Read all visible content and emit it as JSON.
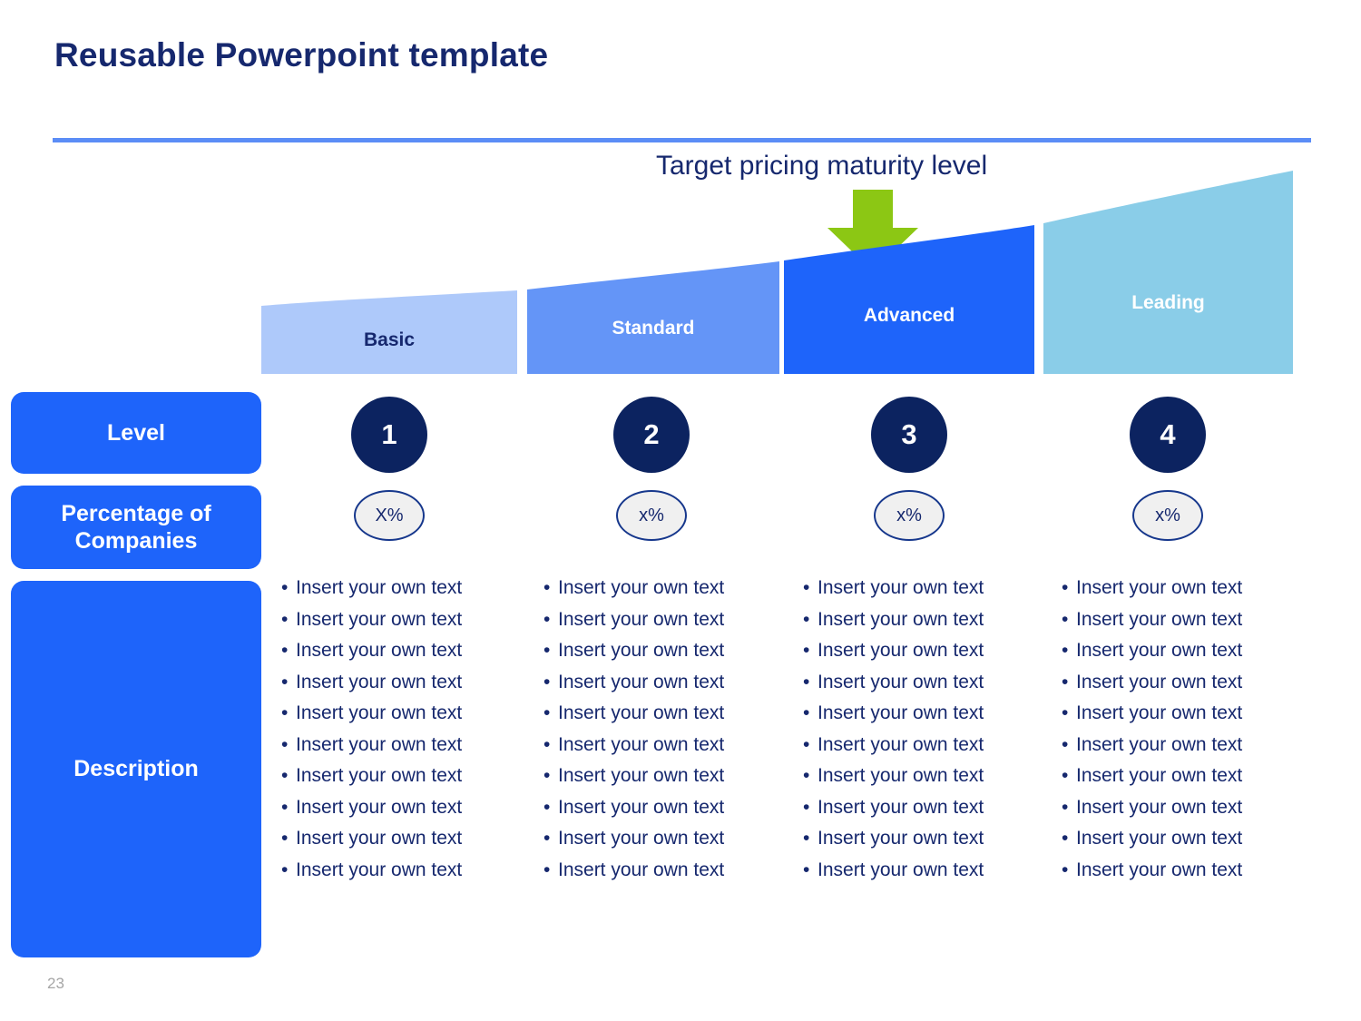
{
  "slide": {
    "title": "Reusable Powerpoint template",
    "page_number": "23",
    "accent_rule_color": "#5B8DF6",
    "title_color": "#16286E"
  },
  "callout": {
    "label": "Target pricing maturity level",
    "arrow_icon": "down-arrow-icon",
    "arrow_color": "#8CC714",
    "points_at": "Advanced"
  },
  "row_headers": {
    "level": "Level",
    "percentage": "Percentage of Companies",
    "description": "Description",
    "background_color": "#1E64FA"
  },
  "bullet_text": "Insert your own text",
  "chart_data": {
    "type": "bar",
    "title": "Target pricing maturity level",
    "xlabel": "",
    "ylabel": "",
    "categories": [
      "Basic",
      "Standard",
      "Advanced",
      "Leading"
    ],
    "values": [
      1,
      2,
      3,
      4
    ],
    "value_label": "Level",
    "grid": false,
    "legend": "none",
    "series": [
      {
        "name": "Maturity level",
        "values": [
          1,
          2,
          3,
          4
        ]
      }
    ],
    "annotations": [
      {
        "text": "Target pricing maturity level",
        "category": "Advanced",
        "icon": "down-arrow-icon"
      }
    ],
    "colors": [
      "#AEC9FA",
      "#6495F7",
      "#1E64FA",
      "#8ACDE8"
    ]
  },
  "columns": [
    {
      "stage": "Basic",
      "stage_text_color": "#16286E",
      "bar_color": "#AEC9FA",
      "level": "1",
      "percentage": "X%",
      "bullets": [
        "Insert your own text",
        "Insert your own text",
        "Insert your own text",
        "Insert your own text",
        "Insert your own text",
        "Insert your own text",
        "Insert your own text",
        "Insert your own text",
        "Insert your own text",
        "Insert your own text"
      ]
    },
    {
      "stage": "Standard",
      "stage_text_color": "#FFFFFF",
      "bar_color": "#6495F7",
      "level": "2",
      "percentage": "x%",
      "bullets": [
        "Insert your own text",
        "Insert your own text",
        "Insert your own text",
        "Insert your own text",
        "Insert your own text",
        "Insert your own text",
        "Insert your own text",
        "Insert your own text",
        "Insert your own text",
        "Insert your own text"
      ]
    },
    {
      "stage": "Advanced",
      "stage_text_color": "#FFFFFF",
      "bar_color": "#1E64FA",
      "level": "3",
      "percentage": "x%",
      "bullets": [
        "Insert your own text",
        "Insert your own text",
        "Insert your own text",
        "Insert your own text",
        "Insert your own text",
        "Insert your own text",
        "Insert your own text",
        "Insert your own text",
        "Insert your own text",
        "Insert your own text"
      ]
    },
    {
      "stage": "Leading",
      "stage_text_color": "#FFFFFF",
      "bar_color": "#8ACDE8",
      "level": "4",
      "percentage": "x%",
      "bullets": [
        "Insert your own text",
        "Insert your own text",
        "Insert your own text",
        "Insert your own text",
        "Insert your own text",
        "Insert your own text",
        "Insert your own text",
        "Insert your own text",
        "Insert your own text",
        "Insert your own text"
      ]
    }
  ]
}
